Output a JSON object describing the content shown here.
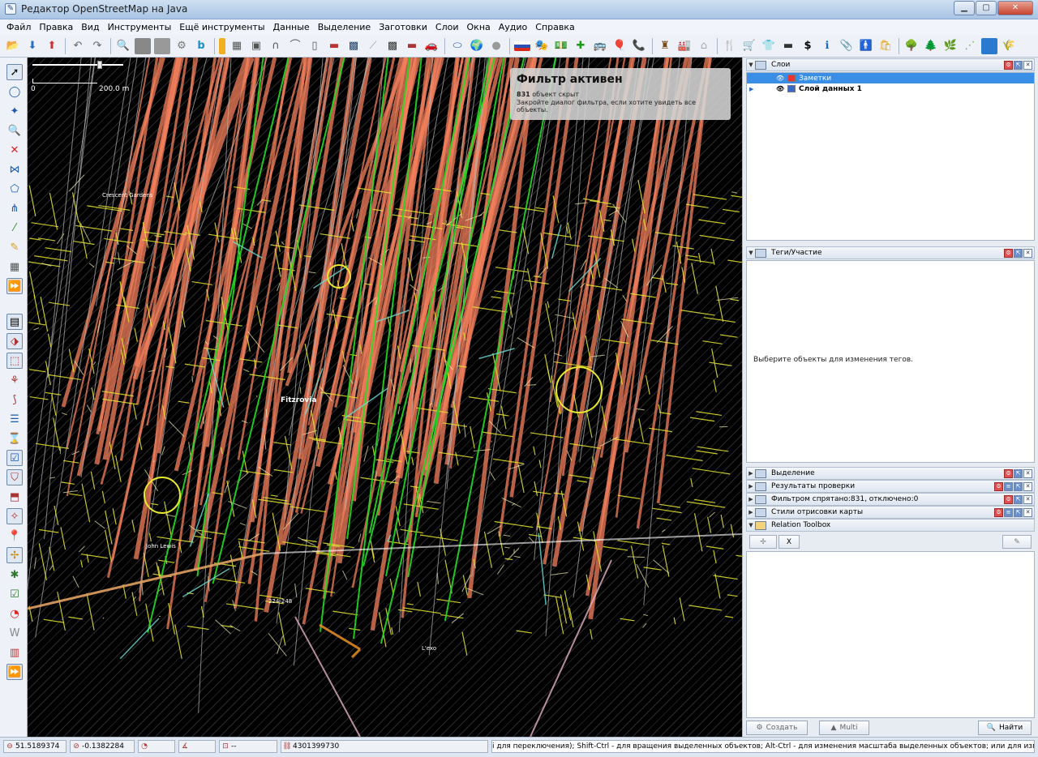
{
  "window": {
    "title": "Редактор OpenStreetMap на Java"
  },
  "menu": [
    "Файл",
    "Правка",
    "Вид",
    "Инструменты",
    "Ещё инструменты",
    "Данные",
    "Выделение",
    "Заготовки",
    "Слои",
    "Окна",
    "Аудио",
    "Справка"
  ],
  "map": {
    "scale_zero": "0",
    "scale_label": "200.0 m",
    "filter_title": "Фильтр активен",
    "filter_count": "831",
    "filter_hidden_text": "объект скрыт",
    "filter_hint": "Закройте диалог фильтра, если хотите увидеть все объекты.",
    "labels": {
      "crescent": "Crescent Gardens",
      "fitzrovia": "Fitzrovia",
      "john_lewis": "John Lewis",
      "address": "224-248",
      "exo": "L'exo"
    }
  },
  "panels": {
    "layers": {
      "title": "Слои",
      "items": [
        {
          "name": "Заметки",
          "selected": true
        },
        {
          "name": "Слой данных 1",
          "selected": false
        }
      ]
    },
    "tags": {
      "title": "Теги/Участие",
      "empty_text": "Выберите объекты для изменения тегов."
    },
    "collapsed": [
      "Выделение",
      "Результаты проверки",
      "Фильтром спрятано:831, отключено:0",
      "Стили отрисовки карты"
    ],
    "relation_toolbox": {
      "title": "Relation Toolbox",
      "clear_label": "X",
      "create_label": "Создать",
      "multi_label": "Multi",
      "find_label": "Найти"
    }
  },
  "status": {
    "lat": "51.5189374",
    "lon": "-0.1382284",
    "distance": "--",
    "node_id": "4301399730",
    "help": "і для переключения); Shift-Ctrl - для вращения выделенных объектов; Alt-Ctrl - для изменения масштаба выделенных объектов; или для изменения выделения"
  },
  "colors": {
    "map_bg": "#000000",
    "road_orange": "#f4805c",
    "way_yellow": "#e8e830",
    "way_green": "#22dd22",
    "selection_blue": "#3a8ee6"
  }
}
